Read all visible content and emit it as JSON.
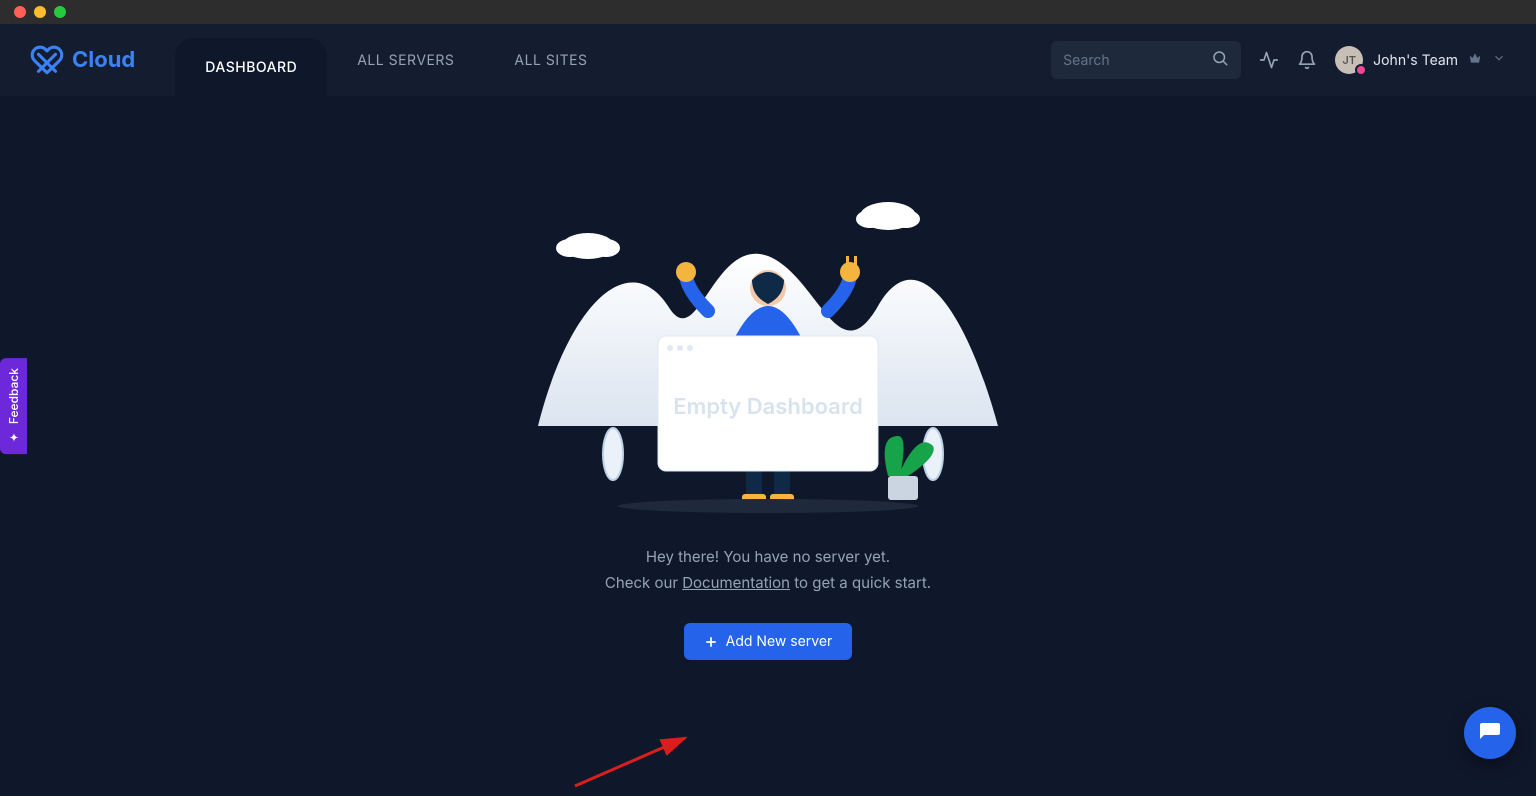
{
  "app": {
    "brand": "Cloud"
  },
  "nav": {
    "dashboard": "DASHBOARD",
    "all_servers": "ALL SERVERS",
    "all_sites": "ALL SITES"
  },
  "search": {
    "placeholder": "Search"
  },
  "team": {
    "avatar_initials": "JT",
    "label": "John's Team"
  },
  "feedback": {
    "label": "Feedback"
  },
  "empty": {
    "card_title": "Empty Dashboard",
    "line1": "Hey there! You have no server yet.",
    "line2_prefix": "Check our ",
    "line2_link": "Documentation",
    "line2_suffix": " to get a quick start."
  },
  "cta": {
    "add_server": "Add New server"
  }
}
